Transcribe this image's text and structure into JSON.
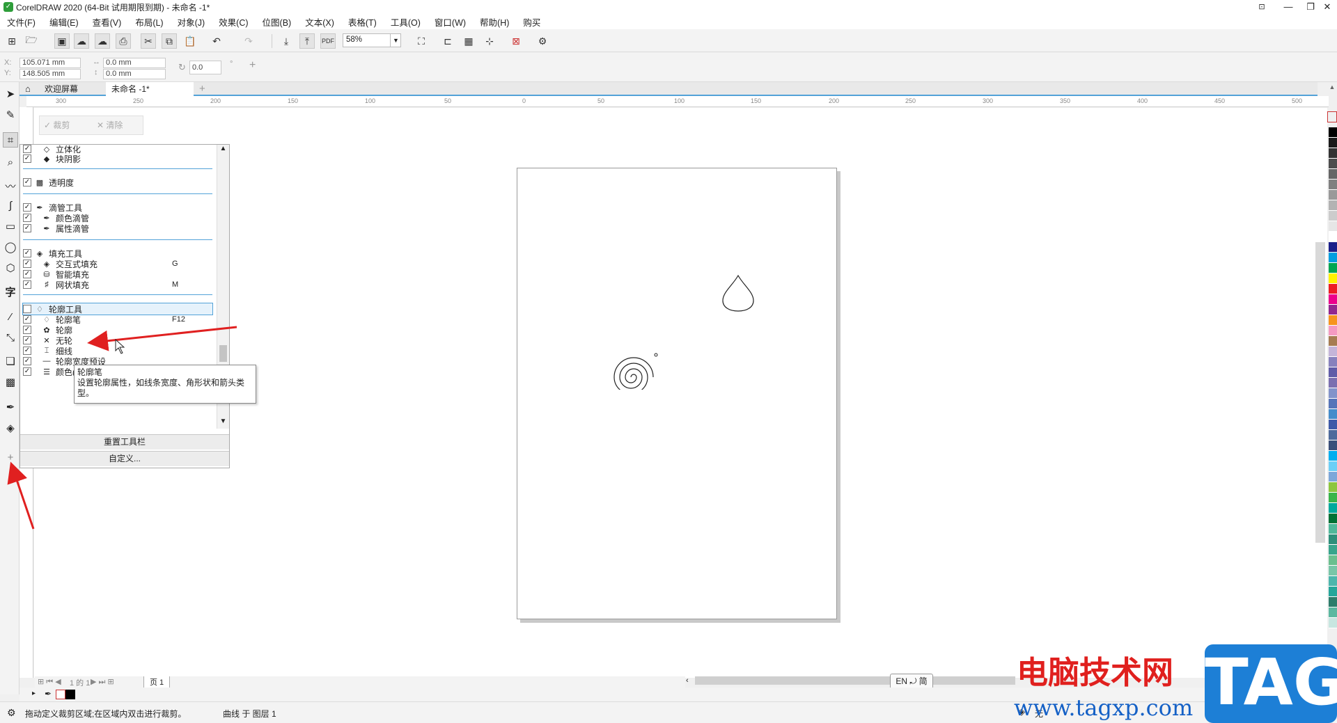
{
  "window": {
    "title": "CorelDRAW 2020 (64-Bit 试用期限到期) - 未命名 -1*"
  },
  "menu": [
    "文件(F)",
    "编辑(E)",
    "查看(V)",
    "布局(L)",
    "对象(J)",
    "效果(C)",
    "位图(B)",
    "文本(X)",
    "表格(T)",
    "工具(O)",
    "窗口(W)",
    "帮助(H)",
    "购买"
  ],
  "toolbar": {
    "zoom": "58%"
  },
  "properties": {
    "x_label": "X:",
    "x_value": "105.071 mm",
    "y_label": "Y:",
    "y_value": "148.505 mm",
    "w_value": "0.0 mm",
    "h_value": "0.0 mm",
    "angle_value": "0.0"
  },
  "tabs": {
    "welcome": "欢迎屏幕",
    "document": "未命名 -1*"
  },
  "ruler": {
    "top_ticks": [
      "300",
      "250",
      "200",
      "150",
      "100",
      "50",
      "0",
      "50",
      "100",
      "150",
      "200",
      "250",
      "300",
      "350",
      "400",
      "450",
      "500"
    ]
  },
  "crop_bar": {
    "apply": "裁剪",
    "clear": "清除"
  },
  "customize_panel": {
    "rows": [
      {
        "label": "立体化",
        "checked": true,
        "indent": true,
        "shortcut": "",
        "icon": "extrude-icon"
      },
      {
        "label": "块阴影",
        "checked": true,
        "indent": true,
        "shortcut": "",
        "icon": "block-shadow-icon"
      },
      {
        "label": "透明度",
        "checked": true,
        "indent": false,
        "shortcut": "",
        "icon": "transparency-icon"
      },
      {
        "label": "滴管工具",
        "checked": true,
        "indent": false,
        "shortcut": "",
        "icon": "eyedropper-icon"
      },
      {
        "label": "颜色滴管",
        "checked": true,
        "indent": true,
        "shortcut": "",
        "icon": "color-eyedropper-icon"
      },
      {
        "label": "属性滴管",
        "checked": true,
        "indent": true,
        "shortcut": "",
        "icon": "attributes-eyedropper-icon"
      },
      {
        "label": "填充工具",
        "checked": true,
        "indent": false,
        "shortcut": "",
        "icon": "fill-icon"
      },
      {
        "label": "交互式填充",
        "checked": true,
        "indent": true,
        "shortcut": "G",
        "icon": "interactive-fill-icon"
      },
      {
        "label": "智能填充",
        "checked": true,
        "indent": true,
        "shortcut": "",
        "icon": "smart-fill-icon"
      },
      {
        "label": "网状填充",
        "checked": true,
        "indent": true,
        "shortcut": "M",
        "icon": "mesh-fill-icon"
      },
      {
        "label": "轮廓工具",
        "checked": false,
        "indent": false,
        "shortcut": "",
        "icon": "outline-icon"
      },
      {
        "label": "轮廓笔",
        "checked": true,
        "indent": true,
        "shortcut": "F12",
        "icon": "outline-pen-icon"
      },
      {
        "label": "轮廓",
        "checked": true,
        "indent": true,
        "shortcut": "",
        "icon": "outline-color-icon"
      },
      {
        "label": "无轮",
        "checked": true,
        "indent": true,
        "shortcut": "",
        "icon": "no-outline-icon"
      },
      {
        "label": "细线",
        "checked": true,
        "indent": true,
        "shortcut": "",
        "icon": "hairline-icon"
      },
      {
        "label": "轮廓宽度预设",
        "checked": true,
        "indent": true,
        "shortcut": "",
        "icon": "outline-width-icon"
      },
      {
        "label": "颜色(C)",
        "checked": true,
        "indent": true,
        "shortcut": "",
        "icon": "color-icon"
      }
    ],
    "reset_label": "重置工具栏",
    "customize_label": "自定义..."
  },
  "tooltip": {
    "title": "轮廓笔",
    "body": "设置轮廓属性，如线条宽度、角形状和箭头类型。"
  },
  "pager": {
    "page_label": "页 1",
    "counter": "1 的 1"
  },
  "language": {
    "label": "EN ⤾ 简"
  },
  "status": {
    "hint": "拖动定义裁剪区域;在区域内双击进行裁剪。",
    "object_info": "曲线 于 图层 1",
    "fill_text": "无"
  },
  "watermark": {
    "title": "电脑技术网",
    "url": "www.tagxp.com",
    "tag": "TAG"
  },
  "palette": [
    "#000000",
    "#1a1a1a",
    "#333333",
    "#4d4d4d",
    "#666666",
    "#808080",
    "#999999",
    "#b3b3b3",
    "#cccccc",
    "#e6e6e6",
    "#ffffff",
    "#1b1f8a",
    "#009ee0",
    "#00a651",
    "#fff200",
    "#ed1c24",
    "#ec008c",
    "#92278f",
    "#f7941d",
    "#f49ac1",
    "#a67c52",
    "#c4b5d9",
    "#8781bd",
    "#605ca8",
    "#7b6fb0",
    "#8393ca",
    "#5674b9",
    "#448ccb",
    "#3e5aa8",
    "#4d6a9c",
    "#3a4f7a",
    "#00aeef",
    "#6dcff6",
    "#7da7d9",
    "#8dc63f",
    "#39b54a",
    "#00a99d",
    "#007236",
    "#4fb89a",
    "#2c8f7a",
    "#37a58c",
    "#6bbf8f",
    "#79c6a8",
    "#4db6ac",
    "#26a69a",
    "#2e7d6b",
    "#5cb8a0",
    "#c8e6e0"
  ],
  "colors": {
    "accent": "#52a2d8",
    "arrow": "#e02020"
  }
}
